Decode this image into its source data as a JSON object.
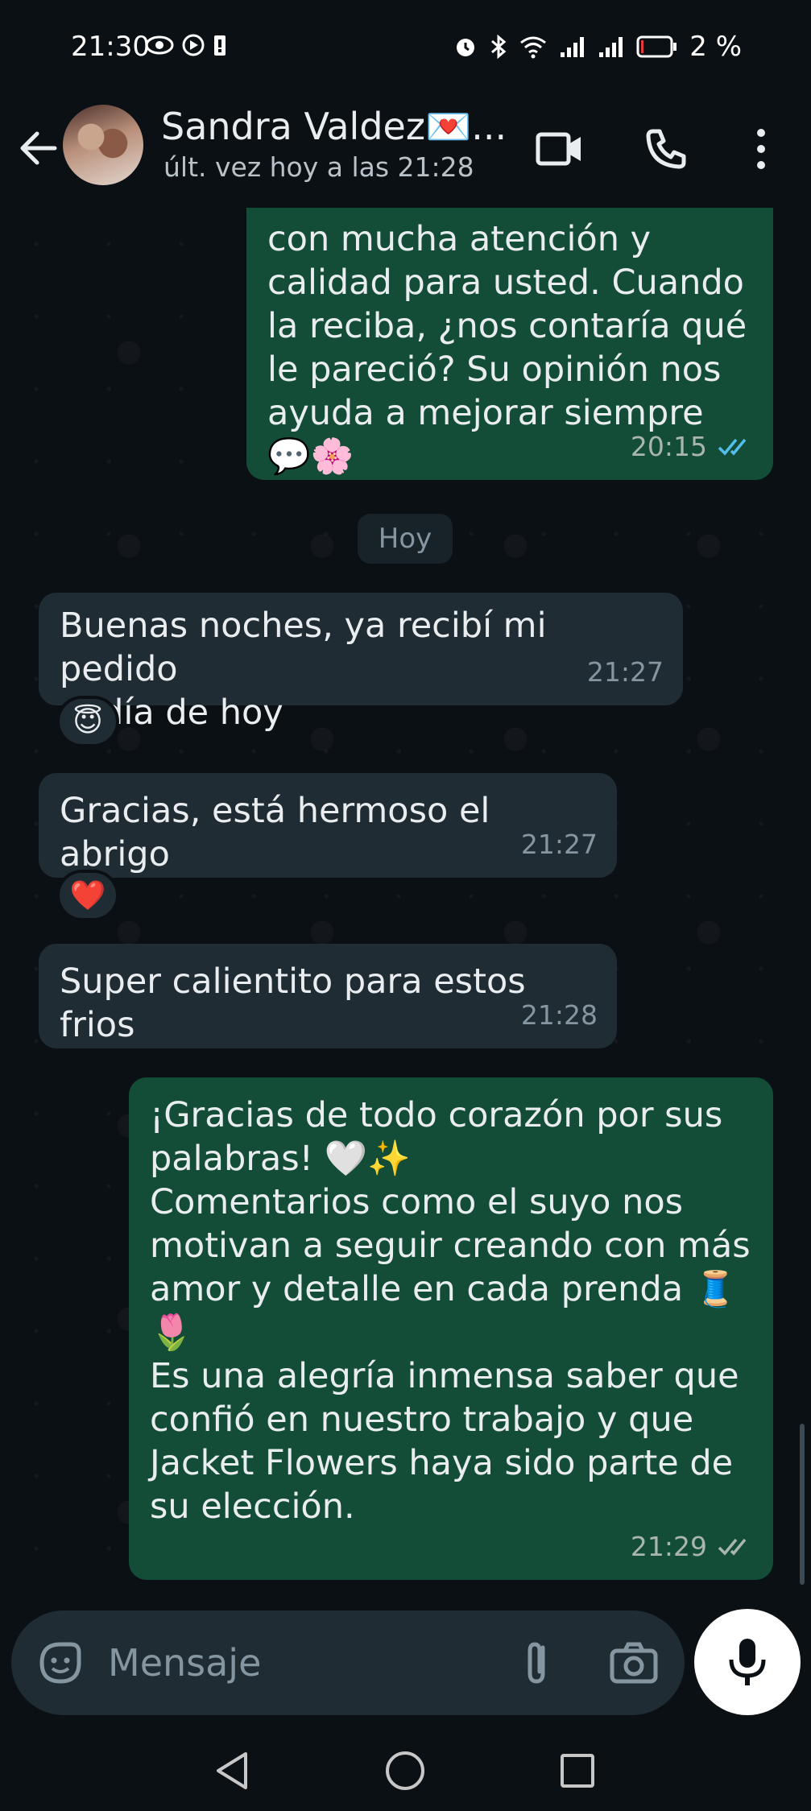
{
  "status_bar": {
    "time": "21:30",
    "battery": "2 %"
  },
  "header": {
    "contact_name": "Sandra Valdez💌...",
    "last_seen": "últ. vez hoy a las 21:28"
  },
  "chat": {
    "day_separator": "Hoy",
    "messages": [
      {
        "direction": "out",
        "text": "con mucha atención y\ncalidad para usted. Cuando\nla reciba, ¿nos contaría qué\nle pareció? Su opinión nos\nayuda a mejorar siempre\n💬🌸",
        "time": "20:15",
        "ticks": "read"
      },
      {
        "direction": "in",
        "text": "Buenas noches, ya recibí mi pedido\nel día de hoy",
        "time": "21:27",
        "reaction": "😇"
      },
      {
        "direction": "in",
        "text": "Gracias, está hermoso el abrigo",
        "time": "21:27",
        "reaction": "❤️"
      },
      {
        "direction": "in",
        "text": "Super calientito para estos frios",
        "time": "21:28"
      },
      {
        "direction": "out",
        "text": "¡Gracias de todo corazón por sus\npalabras! 🤍✨\nComentarios como el suyo nos\nmotivan a seguir creando con más\namor y detalle en cada prenda 🧵\n🌷\nEs una alegría inmensa saber que\nconfió en nuestro trabajo y que\nJacket Flowers haya sido parte de\nsu elección.",
        "time": "21:29",
        "ticks": "delivered"
      }
    ]
  },
  "input": {
    "placeholder": "Mensaje"
  },
  "colors": {
    "outgoing_bubble": "#144d37",
    "incoming_bubble": "#1f2c33",
    "read_tick": "#53bdeb",
    "background": "#0b1014"
  }
}
